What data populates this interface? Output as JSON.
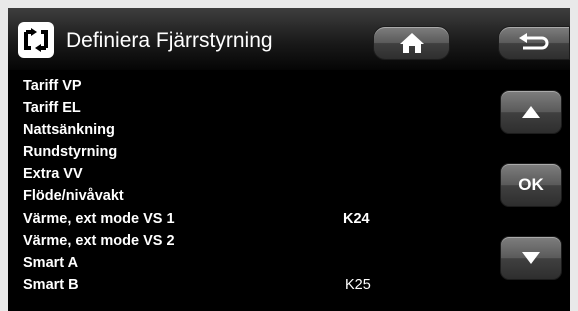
{
  "header": {
    "title": "Definiera Fjärrstyrning",
    "icon": "remote-control-arrows-icon"
  },
  "buttons": {
    "home_icon": "home-icon",
    "back_icon": "return-arrow-icon",
    "up_icon": "triangle-up-icon",
    "ok_label": "OK",
    "down_icon": "triangle-down-icon"
  },
  "list": {
    "rows": [
      {
        "label": "Tariff VP",
        "value": ""
      },
      {
        "label": "Tariff EL",
        "value": ""
      },
      {
        "label": "Nattsänkning",
        "value": ""
      },
      {
        "label": "Rundstyrning",
        "value": ""
      },
      {
        "label": "Extra VV",
        "value": ""
      },
      {
        "label": "Flöde/nivåvakt",
        "value": ""
      },
      {
        "label": "Värme, ext mode VS 1",
        "value": "K24"
      },
      {
        "label": "Värme, ext mode VS 2",
        "value": ""
      },
      {
        "label": "Smart A",
        "value": ""
      },
      {
        "label": "Smart B",
        "value": "K25"
      }
    ]
  },
  "colors": {
    "background": "#000000",
    "text": "#ffffff",
    "button": "#5a5a5a"
  }
}
